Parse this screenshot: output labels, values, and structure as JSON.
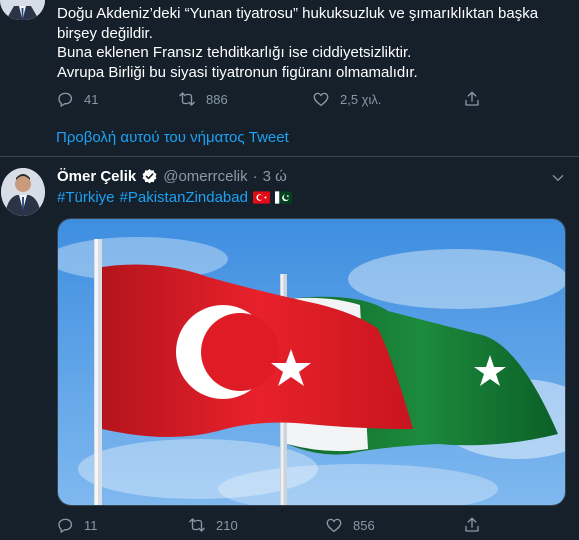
{
  "prev_tweet": {
    "lines": [
      "Doğu Akdeniz’deki “Yunan tiyatrosu” hukuksuzluk ve şımarıklıktan başka",
      "birşey değildir.",
      "Buna eklenen Fransız tehditkarlığı ise ciddiyetsizliktir.",
      "Avrupa Birliği bu siyasi tiyatronun figüranı olmamalıdır."
    ],
    "replies": "41",
    "retweets": "886",
    "likes": "2,5 χιλ.",
    "icons": [
      "reply-icon",
      "retweet-icon",
      "like-icon",
      "share-icon"
    ]
  },
  "thread_link": "Προβολή αυτού του νήματος Tweet",
  "tweet": {
    "name": "Ömer Çelik",
    "handle": "@omerrcelik",
    "separator": "·",
    "time": "3 ώ",
    "hashtag1": "#Türkiye",
    "hashtag2": "#PakistanZindabad",
    "replies": "11",
    "retweets": "210",
    "likes": "856"
  },
  "colors": {
    "background": "#15202b",
    "accent": "#1da1f2",
    "muted": "#8899a6",
    "turkey_red": "#e30a17",
    "pakistan_green": "#01411c"
  }
}
